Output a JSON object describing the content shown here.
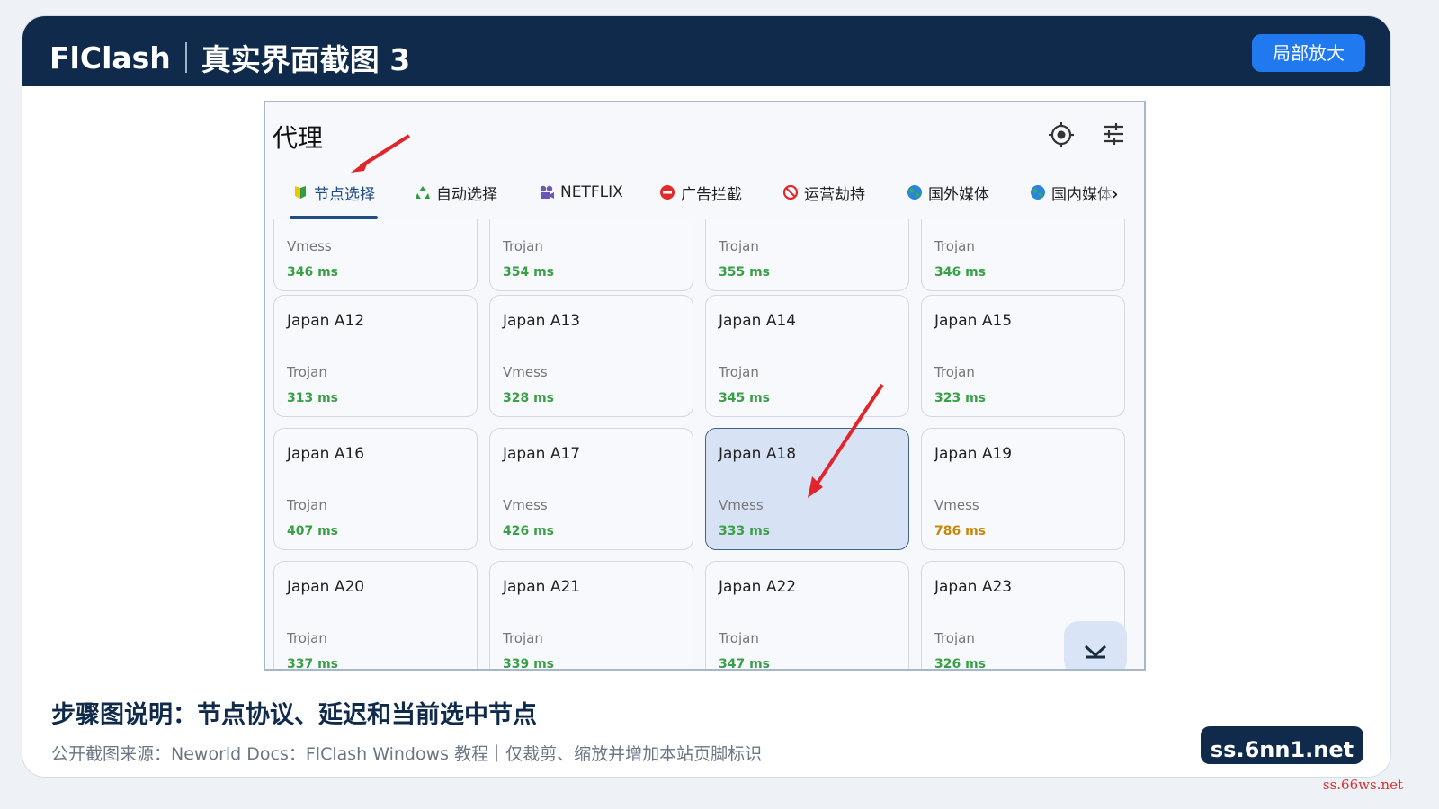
{
  "header": {
    "brand": "FlClash",
    "subtitle": "真实界面截图 3",
    "zoom_button": "局部放大"
  },
  "app": {
    "title": "代理",
    "icons": {
      "locate": "crosshair-icon",
      "settings": "tune-sliders-icon"
    },
    "tabs": [
      {
        "label": "节点选择",
        "icon": "beginner-shield-icon",
        "active": true
      },
      {
        "label": "自动选择",
        "icon": "recycle-icon"
      },
      {
        "label": "NETFLIX",
        "icon": "film-projector-icon"
      },
      {
        "label": "广告拦截",
        "icon": "no-entry-icon"
      },
      {
        "label": "运营劫持",
        "icon": "prohibited-icon"
      },
      {
        "label": "国外媒体",
        "icon": "globe-icon"
      },
      {
        "label": "国内媒体",
        "icon": "globe-icon"
      }
    ],
    "nodes": [
      {
        "name": "",
        "protocol": "Vmess",
        "delay": "346 ms"
      },
      {
        "name": "",
        "protocol": "Trojan",
        "delay": "354 ms"
      },
      {
        "name": "",
        "protocol": "Trojan",
        "delay": "355 ms"
      },
      {
        "name": "",
        "protocol": "Trojan",
        "delay": "346 ms"
      },
      {
        "name": "Japan A12",
        "protocol": "Trojan",
        "delay": "313 ms"
      },
      {
        "name": "Japan A13",
        "protocol": "Vmess",
        "delay": "328 ms"
      },
      {
        "name": "Japan A14",
        "protocol": "Trojan",
        "delay": "345 ms"
      },
      {
        "name": "Japan A15",
        "protocol": "Trojan",
        "delay": "323 ms"
      },
      {
        "name": "Japan A16",
        "protocol": "Trojan",
        "delay": "407 ms"
      },
      {
        "name": "Japan A17",
        "protocol": "Vmess",
        "delay": "426 ms"
      },
      {
        "name": "Japan A18",
        "protocol": "Vmess",
        "delay": "333 ms",
        "selected": true
      },
      {
        "name": "Japan A19",
        "protocol": "Vmess",
        "delay": "786 ms",
        "warn": true
      },
      {
        "name": "Japan A20",
        "protocol": "Trojan",
        "delay": "337 ms"
      },
      {
        "name": "Japan A21",
        "protocol": "Trojan",
        "delay": "339 ms"
      },
      {
        "name": "Japan A22",
        "protocol": "Trojan",
        "delay": "347 ms"
      },
      {
        "name": "Japan A23",
        "protocol": "Trojan",
        "delay": "326 ms"
      }
    ],
    "fab_icon": "scroll-to-bottom-icon"
  },
  "caption": {
    "title": "步骤图说明：节点协议、延迟和当前选中节点",
    "source": "公开截图来源：Neworld Docs：FlClash Windows 教程｜仅裁剪、缩放并增加本站页脚标识"
  },
  "site_badge": "ss.6nn1.net",
  "watermark": "ss.66ws.net",
  "colors": {
    "header_bg": "#0f2a4a",
    "accent": "#2079ee",
    "delay_ok": "#3aa047",
    "delay_warn": "#c8870a",
    "arrow": "#e0252b"
  }
}
